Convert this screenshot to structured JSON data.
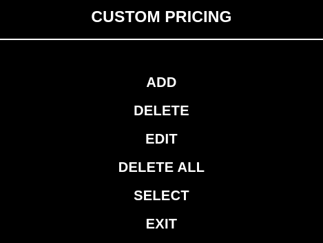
{
  "header": {
    "title": "CUSTOM PRICING"
  },
  "menu": {
    "items": [
      {
        "label": "ADD"
      },
      {
        "label": "DELETE"
      },
      {
        "label": "EDIT"
      },
      {
        "label": "DELETE ALL"
      },
      {
        "label": "SELECT"
      },
      {
        "label": "EXIT"
      }
    ]
  },
  "colors": {
    "background": "#000000",
    "text": "#ffffff",
    "divider": "#ffffff"
  }
}
